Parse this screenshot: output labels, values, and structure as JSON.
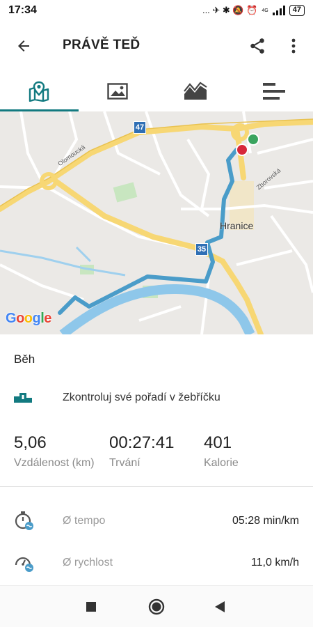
{
  "status": {
    "time": "17:34",
    "icons": "... ✈ ✱ 🔕 ⏰",
    "network": "4G",
    "battery": "47"
  },
  "header": {
    "title": "PRÁVĚ TEĎ"
  },
  "tabs": [
    {
      "name": "map-tab",
      "icon": "map-pin-icon",
      "active": true
    },
    {
      "name": "photos-tab",
      "icon": "image-icon",
      "active": false
    },
    {
      "name": "chart-tab",
      "icon": "area-chart-icon",
      "active": false
    },
    {
      "name": "laps-tab",
      "icon": "bars-icon",
      "active": false
    }
  ],
  "map": {
    "city": "Hranice",
    "road_47": "47",
    "road_35": "35",
    "street_1": "Olomoucká",
    "street_2": "Zborovská",
    "logo": "Google",
    "colors": {
      "route": "#4a9cc9",
      "highway": "#f7d774",
      "river": "#8ec7ea",
      "start": "#3aa45f",
      "end": "#d7283a"
    }
  },
  "activity": {
    "sport": "Běh",
    "leaderboard": "Zkontroluj své pořadí v žebříčku"
  },
  "stats": {
    "distance_value": "5,06",
    "distance_label": "Vzdálenost (km)",
    "duration_value": "00:27:41",
    "duration_label": "Trvání",
    "calories_value": "401",
    "calories_label": "Kalorie"
  },
  "details": [
    {
      "label": "Ø tempo",
      "value": "05:28 min/km",
      "icon": "pace-icon"
    },
    {
      "label": "Ø rychlost",
      "value": "11,0 km/h",
      "icon": "speed-icon"
    }
  ],
  "accent": "#127a80"
}
